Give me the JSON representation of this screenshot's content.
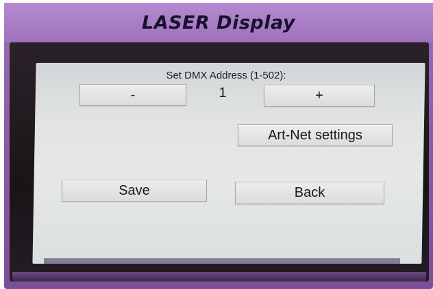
{
  "device": {
    "title": "LASER Display"
  },
  "dmx": {
    "label": "Set DMX Address (1-502):",
    "value": "1",
    "decrement_label": "-",
    "increment_label": "+"
  },
  "buttons": {
    "artnet_label": "Art-Net settings",
    "save_label": "Save",
    "back_label": "Back"
  },
  "colors": {
    "case_purple": "#9b6fb8",
    "bezel": "#1a1418",
    "screen": "#e2e4e4",
    "button": "#e4e4e4"
  }
}
